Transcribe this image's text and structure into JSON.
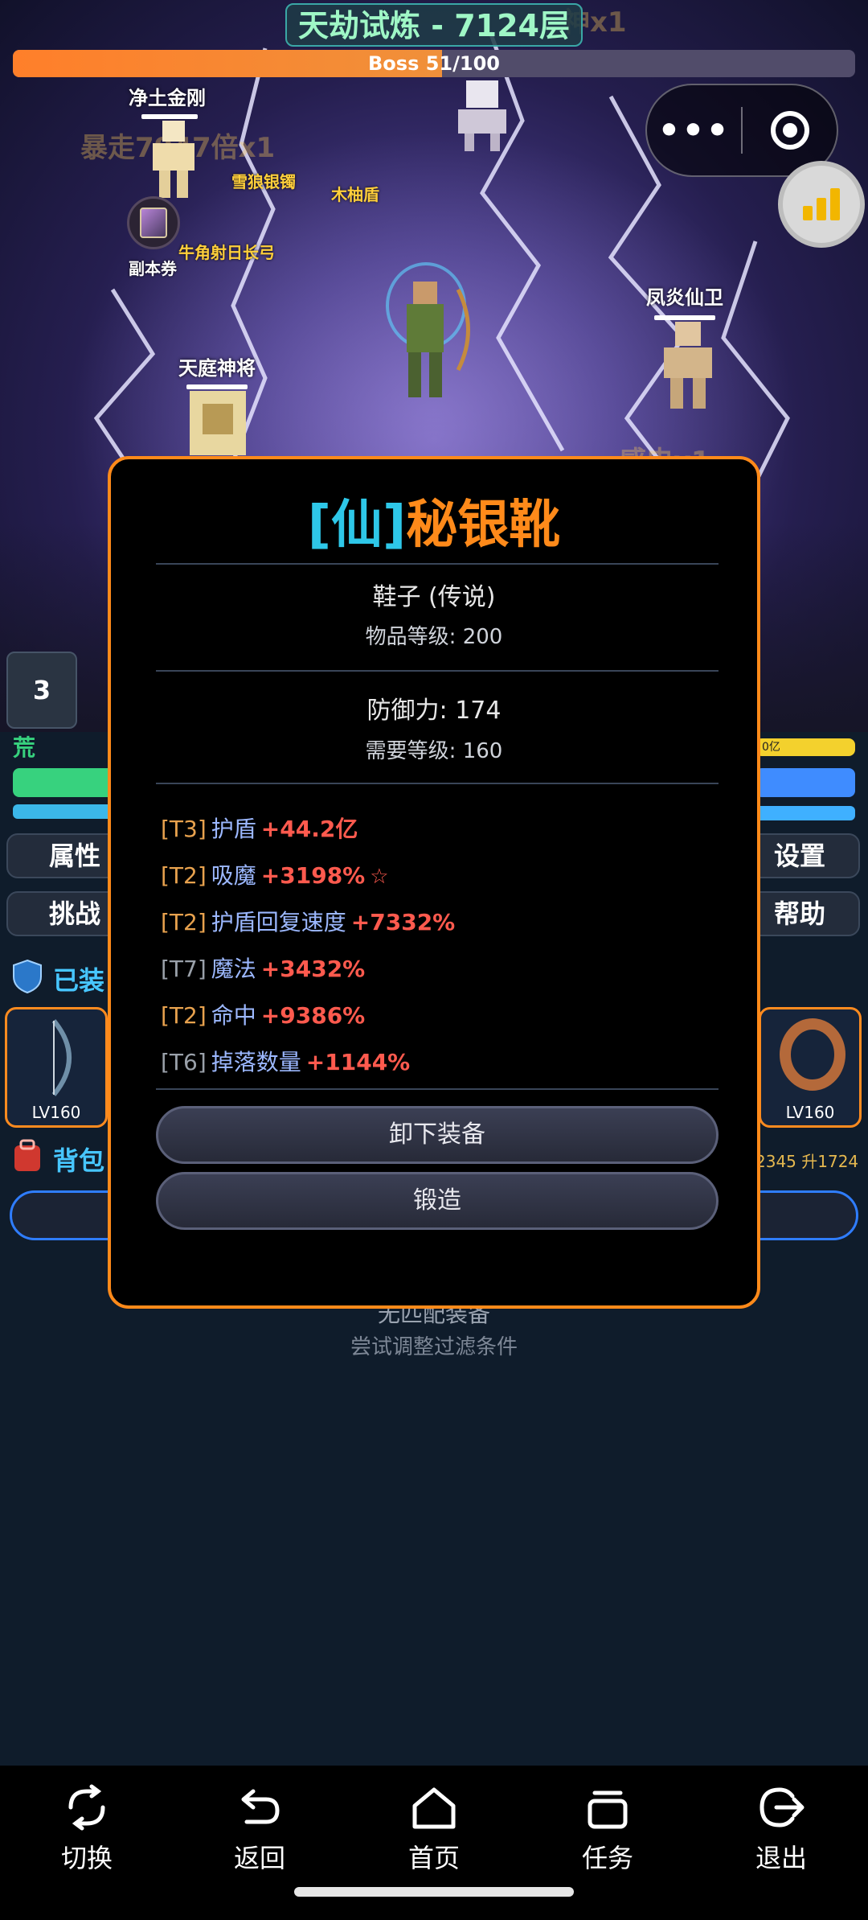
{
  "scene": {
    "stage_title": "天劫试炼 - 7124层",
    "boss_progress_text": "Boss 51/100",
    "boss_progress_fraction": 0.51,
    "units": {
      "jingtu": "净土金刚",
      "tianting": "天庭神将",
      "fengyan": "凤炎仙卫"
    },
    "drops": {
      "xuelang": "雪狼银镯",
      "muyou": "木柚盾",
      "niujiao": "牛角射日长弓",
      "ticket": "副本券"
    },
    "faded_text": {
      "top": "神x1",
      "left": "暴走7947倍x1",
      "right": "感电x1"
    }
  },
  "hud": {
    "slot_count": "3",
    "left_badge": "荒",
    "right_bar": "0亿",
    "buttons": {
      "attr": "属性",
      "challenge": "挑战",
      "settings": "设置",
      "help": "帮助"
    },
    "equipped_head": "已装",
    "backpack_head": "背包",
    "equip_left_lv": "LV160",
    "equip_right_lv": "LV160",
    "resources": "2345 升1724",
    "empty_text": "无匹配装备",
    "empty_hint": "尝试调整过滤条件"
  },
  "modal": {
    "tag": "[仙]",
    "name": "秘银靴",
    "type_line": "鞋子 (传说)",
    "item_level": "物品等级: 200",
    "defense": "防御力: 174",
    "required_level": "需要等级: 160",
    "affixes": [
      {
        "tier": "[T3]",
        "stat": "护盾",
        "value": "+44.2亿",
        "star": ""
      },
      {
        "tier": "[T2]",
        "stat": "吸魔",
        "value": "+3198%",
        "star": "☆"
      },
      {
        "tier": "[T2]",
        "stat": "护盾回复速度",
        "value": "+7332%",
        "star": ""
      },
      {
        "tier": "[T7]",
        "stat": "魔法",
        "value": "+3432%",
        "star": ""
      },
      {
        "tier": "[T2]",
        "stat": "命中",
        "value": "+9386%",
        "star": ""
      },
      {
        "tier": "[T6]",
        "stat": "掉落数量",
        "value": "+1144%",
        "star": ""
      }
    ],
    "unequip_label": "卸下装备",
    "forge_label": "锻造"
  },
  "nav": {
    "switch": "切换",
    "back": "返回",
    "home": "首页",
    "tasks": "任务",
    "exit": "退出"
  },
  "colors": {
    "accent_orange": "#ff8a1a",
    "tag_cyan": "#2ec7e8",
    "value_red": "#ff5a4e"
  }
}
